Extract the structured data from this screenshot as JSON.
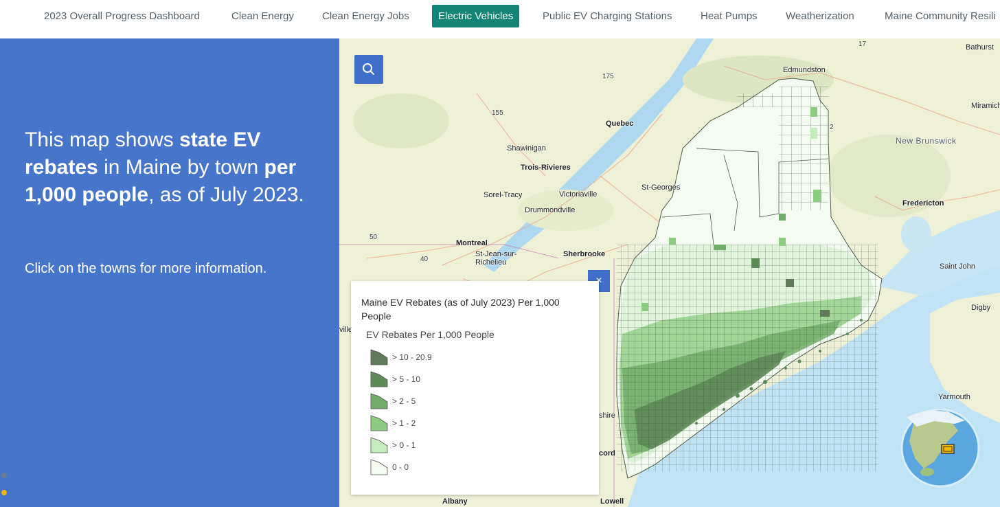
{
  "nav": {
    "tabs": [
      {
        "label": "2023 Overall Progress Dashboard",
        "active": false
      },
      {
        "label": "Clean Energy",
        "active": false
      },
      {
        "label": "Clean Energy Jobs",
        "active": false
      },
      {
        "label": "Electric Vehicles",
        "active": true
      },
      {
        "label": "Public EV Charging Stations",
        "active": false
      },
      {
        "label": "Heat Pumps",
        "active": false
      },
      {
        "label": "Weatherization",
        "active": false
      },
      {
        "label": "Maine Community Resili",
        "active": false
      }
    ]
  },
  "sidebar": {
    "lead": {
      "t1": "This map shows ",
      "b1": "state EV rebates",
      "t2": " in Maine by town ",
      "b2": "per 1,000 people",
      "t3": ", as of July 2023."
    },
    "hint": "Click on the towns for more information."
  },
  "map": {
    "labels": {
      "edmundston": "Edmundston",
      "bathurst": "Bathurst",
      "miramichi": "Miramich",
      "new_brunswick": "New Brunswick",
      "quebec": "Quebec",
      "shawinigan": "Shawinigan",
      "trois_rivieres": "Trois-Rivieres",
      "victoriaville": "Victoriaville",
      "st_georges": "St-Georges",
      "sorel_tracy": "Sorel-Tracy",
      "drummondville": "Drummondville",
      "montreal": "Montreal",
      "st_jean": "St-Jean-sur-Richelieu",
      "sherbrooke": "Sherbrooke",
      "fredericton": "Fredericton",
      "saint_john": "Saint John",
      "digby": "Digby",
      "yarmouth": "Yarmouth",
      "concord": "cord",
      "albany": "Albany",
      "lowell": "Lowell",
      "ville": "ville",
      "shire": "shire",
      "r175": "175",
      "r155": "155",
      "r50": "50",
      "r40": "40",
      "r17": "17",
      "r2": "2"
    }
  },
  "legend": {
    "title": "Maine EV Rebates (as of July 2023) Per 1,000 People",
    "subtitle": "EV Rebates Per 1,000 People",
    "classes": [
      {
        "label": "> 10 - 20.9",
        "color": "#5e7a58"
      },
      {
        "label": "> 5 - 10",
        "color": "#5e8a58"
      },
      {
        "label": "> 2 - 5",
        "color": "#73ab6a"
      },
      {
        "label": "> 1 - 2",
        "color": "#8ccc81"
      },
      {
        "label": "> 0 - 1",
        "color": "#c4ebbc"
      },
      {
        "label": "0 - 0",
        "color": "#f4fbf1"
      }
    ],
    "close_symbol": "×"
  },
  "colors": {
    "accent": "#138577",
    "sidebar": "#4775ca",
    "button": "#3f6fc9",
    "water": "#bfe3f5",
    "land": "#eef0d6"
  }
}
